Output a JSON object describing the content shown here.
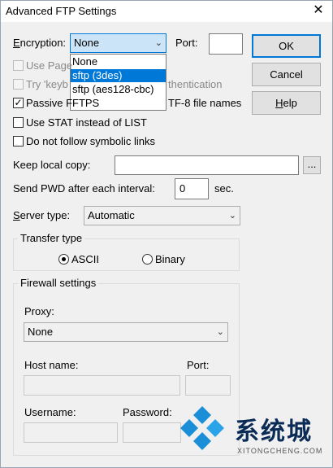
{
  "window": {
    "title": "Advanced FTP Settings",
    "close_glyph": "✕"
  },
  "encryption": {
    "label": "Encryption:",
    "selected": "None",
    "options": [
      "None",
      "sftp (3des)",
      "sftp (aes128-cbc)",
      "FTPS"
    ],
    "highlighted": "sftp (3des)"
  },
  "port": {
    "label": "Port:",
    "value": ""
  },
  "buttons": {
    "ok": "OK",
    "cancel": "Cancel",
    "help": "Help"
  },
  "checkboxes": {
    "use_page": {
      "label": "Use Page",
      "checked": false,
      "enabled": false
    },
    "try_keyb": {
      "label_left": "Try 'keyb",
      "label_right": "thentication",
      "checked": false,
      "enabled": false
    },
    "passive": {
      "label_left": "Passive F",
      "label_right": "TF-8 file names",
      "checked": true,
      "enabled": true
    },
    "use_stat": {
      "label": "Use STAT instead of LIST",
      "checked": false,
      "enabled": true
    },
    "no_symlinks": {
      "label": "Do not follow symbolic links",
      "checked": false,
      "enabled": true
    }
  },
  "keep_local_copy": {
    "label": "Keep local copy:",
    "value": "",
    "browse": "..."
  },
  "send_pwd": {
    "label": "Send PWD after each interval:",
    "value": "0",
    "unit": "sec."
  },
  "server_type": {
    "label": "Server type:",
    "value": "Automatic"
  },
  "transfer_type": {
    "title": "Transfer type",
    "ascii": "ASCII",
    "binary": "Binary",
    "selected": "ASCII"
  },
  "firewall": {
    "title": "Firewall settings",
    "proxy_label": "Proxy:",
    "proxy_value": "None",
    "host_label": "Host name:",
    "port_label": "Port:",
    "username_label": "Username:",
    "password_label": "Password:"
  },
  "watermark": {
    "text": "系统城",
    "sub": "XITONGCHENG.COM"
  },
  "colors": {
    "accent": "#0078d7",
    "watermark_blue": "#1a8fd8",
    "watermark_text": "#0a2b55"
  }
}
